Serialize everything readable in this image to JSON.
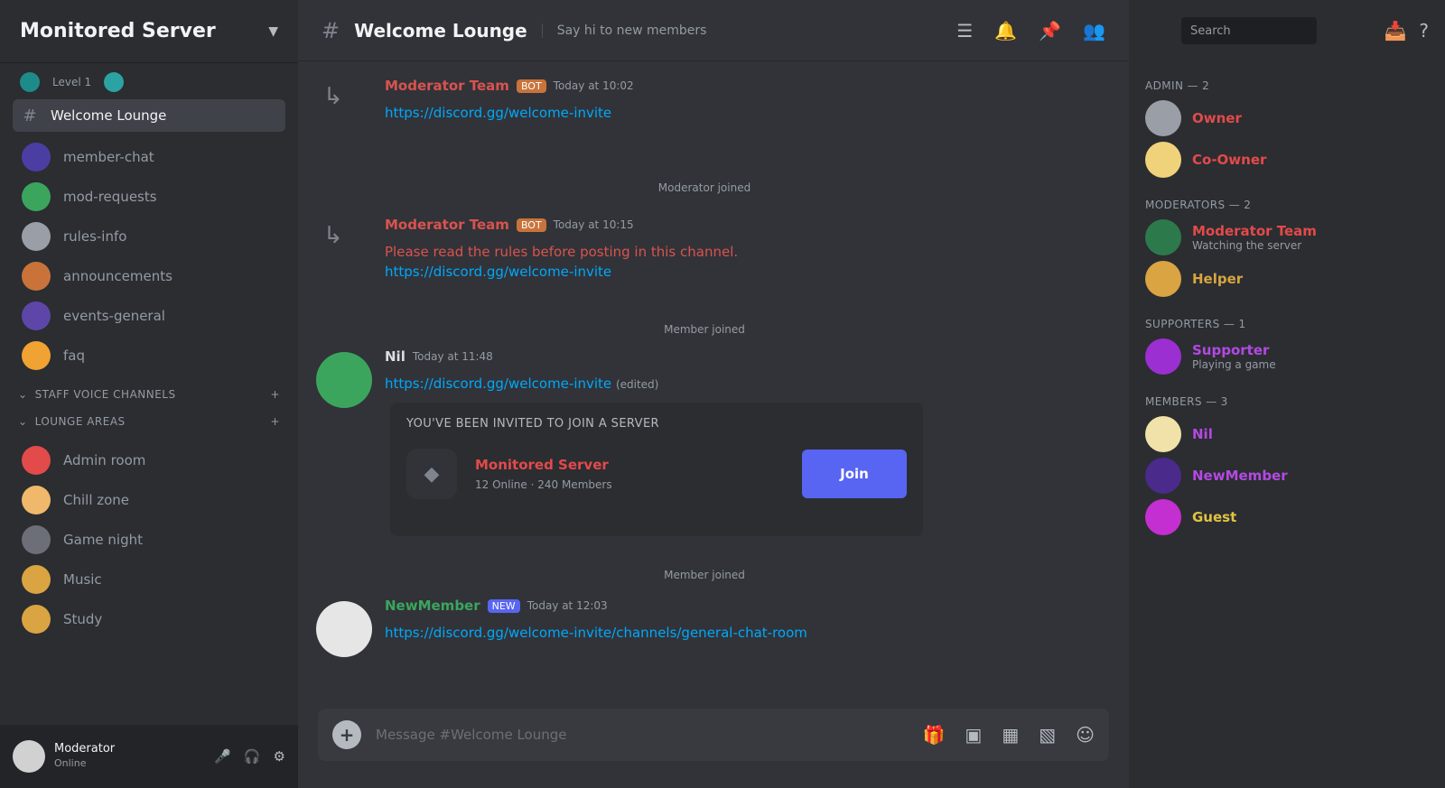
{
  "sidebar": {
    "server_name": "Monitored Server",
    "boost_label": "Level 1",
    "channels": [
      {
        "label": "Welcome Lounge",
        "color": "#5865f2",
        "active": true,
        "kind": "hash"
      },
      {
        "label": "member-chat",
        "color": "#4b3ea3",
        "kind": "avatar"
      },
      {
        "label": "mod-requests",
        "color": "#3ba55d",
        "kind": "avatar"
      },
      {
        "label": "rules-info",
        "color": "#9a9ea6",
        "kind": "avatar"
      },
      {
        "label": "announcements",
        "color": "#c9733a",
        "kind": "avatar"
      },
      {
        "label": "events-general",
        "color": "#5e46a8",
        "kind": "avatar"
      },
      {
        "label": "faq",
        "color": "#f0a232",
        "kind": "avatar"
      }
    ],
    "categories": [
      {
        "label": "Staff Voice Channels"
      },
      {
        "label": "Lounge Areas"
      }
    ],
    "voice": [
      {
        "label": "Admin room",
        "color": "#e34a4a"
      },
      {
        "label": "Chill zone",
        "color": "#f0b86a"
      },
      {
        "label": "Game night",
        "color": "#6d6f78"
      },
      {
        "label": "Music",
        "color": "#d9a441"
      },
      {
        "label": "Study",
        "color": "#d9a441"
      }
    ],
    "user": {
      "name": "Moderator",
      "status": "Online"
    }
  },
  "main": {
    "channel_name": "Welcome Lounge",
    "topic": "Say hi to new members",
    "messages": [
      {
        "author": "Moderator Team",
        "author_color": "#d9534f",
        "badge": "BOT",
        "time": "Today at 10:02",
        "text": "https://discord.gg/welcome-invite"
      },
      {
        "system": "Moderator joined"
      },
      {
        "author": "Moderator Team",
        "author_color": "#d9534f",
        "badge": "BOT",
        "time": "Today at 10:15",
        "alt": "Please read the rules before posting in this channel.",
        "text": "https://discord.gg/welcome-invite"
      },
      {
        "system": "Member joined"
      },
      {
        "author": "Nil",
        "author_color": "#dbdee1",
        "time": "Today at 11:48",
        "text": "https://discord.gg/welcome-invite",
        "suffix": "(edited)"
      },
      {
        "system": "Member joined"
      },
      {
        "author": "NewMember",
        "author_color": "#3ba55d",
        "badge": "NEW",
        "time": "Today at 12:03",
        "text": "https://discord.gg/welcome-invite/channels/general-chat-room"
      }
    ],
    "invite_embed": {
      "title": "You've been invited to join a server",
      "server": "Monitored Server",
      "sub": "12 Online · 240 Members",
      "button": "Join"
    },
    "composer_placeholder": "Message #Welcome Lounge"
  },
  "members_panel": {
    "search_placeholder": "Search",
    "groups": [
      {
        "heading": "Admin — 2",
        "members": [
          {
            "name": "Owner",
            "color": "#e34a4a",
            "status": "",
            "avatar": "#9a9ea6"
          },
          {
            "name": "Co-Owner",
            "color": "#e34a4a",
            "status": "",
            "avatar": "#f0d27a"
          }
        ]
      },
      {
        "heading": "Moderators — 2",
        "members": [
          {
            "name": "Moderator Team",
            "color": "#e34a4a",
            "status": "Watching the server",
            "avatar": "#2c7a4b"
          },
          {
            "name": "Helper",
            "color": "#d9a441",
            "status": "",
            "avatar": "#d9a441"
          }
        ]
      },
      {
        "heading": "Supporters — 1",
        "members": [
          {
            "name": "Supporter",
            "color": "#b349e3",
            "status": "Playing a game",
            "avatar": "#9b2fd1"
          }
        ]
      },
      {
        "heading": "Members — 3",
        "members": [
          {
            "name": "Nil",
            "color": "#b349e3",
            "status": "",
            "avatar": "#f0e2a8"
          },
          {
            "name": "NewMember",
            "color": "#b349e3",
            "status": "",
            "avatar": "#4a2a8a"
          },
          {
            "name": "Guest",
            "color": "#e0c341",
            "status": "",
            "avatar": "#c42fd1"
          }
        ]
      }
    ]
  }
}
